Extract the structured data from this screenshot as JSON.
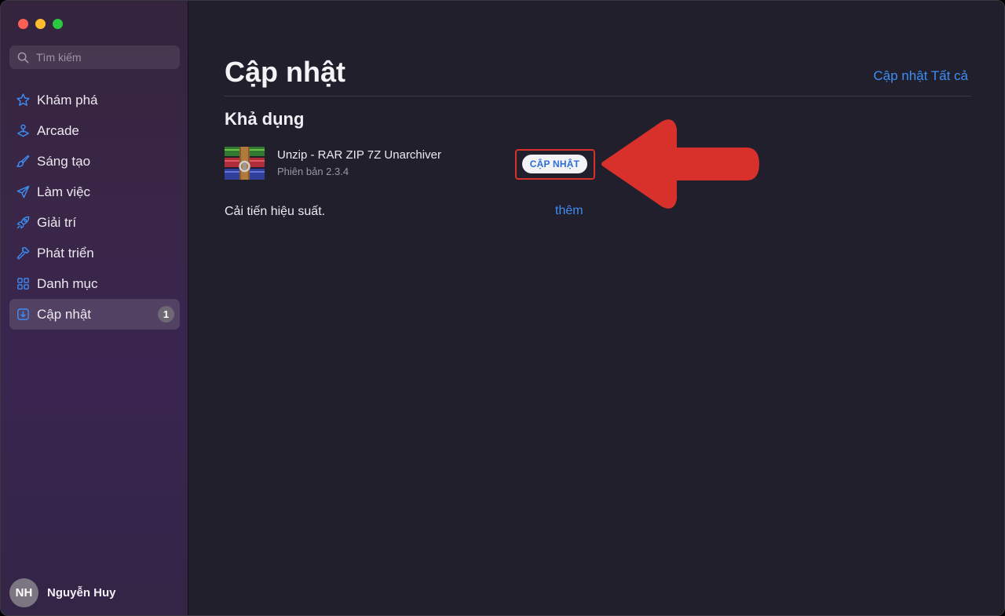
{
  "sidebar": {
    "search_placeholder": "Tìm kiếm",
    "items": [
      {
        "label": "Khám phá",
        "icon": "star-icon"
      },
      {
        "label": "Arcade",
        "icon": "joystick-icon"
      },
      {
        "label": "Sáng tạo",
        "icon": "brush-icon"
      },
      {
        "label": "Làm việc",
        "icon": "paper-plane-icon"
      },
      {
        "label": "Giải trí",
        "icon": "rocket-icon"
      },
      {
        "label": "Phát triển",
        "icon": "hammer-icon"
      },
      {
        "label": "Danh mục",
        "icon": "grid-icon"
      },
      {
        "label": "Cập nhật",
        "icon": "download-icon",
        "badge": "1",
        "active": true
      }
    ],
    "user": {
      "initials": "NH",
      "name": "Nguyễn Huy"
    }
  },
  "main": {
    "title": "Cập nhật",
    "update_all": "Cập nhật Tất cả",
    "section_title": "Khả dụng",
    "app": {
      "name": "Unzip - RAR ZIP 7Z Unarchiver",
      "version": "Phiên bản 2.3.4",
      "icon": "rar-archive-icon",
      "button_label": "CẬP NHẬT"
    },
    "release_notes": "Cải tiến hiệu suất.",
    "more_link": "thêm"
  },
  "colors": {
    "accent": "#3d8df5",
    "annotation_red": "#d8312c",
    "sidebar_bg": "#3a2647",
    "main_bg": "#211f2b"
  }
}
